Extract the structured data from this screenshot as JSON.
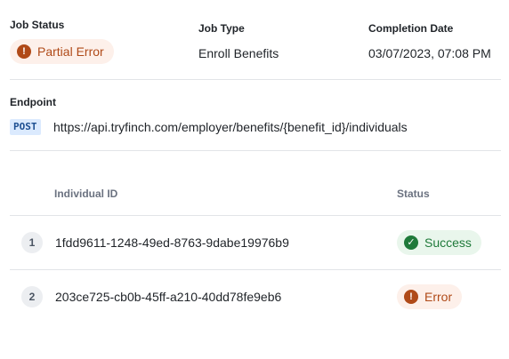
{
  "job_status": {
    "label": "Job Status",
    "value": "Partial Error",
    "icon": "alert-circle-icon",
    "color": "#b04a18"
  },
  "job_type": {
    "label": "Job Type",
    "value": "Enroll Benefits"
  },
  "completion_date": {
    "label": "Completion Date",
    "value": "03/07/2023, 07:08 PM"
  },
  "endpoint": {
    "label": "Endpoint",
    "method": "POST",
    "url": "https://api.tryfinch.com/employer/benefits/{benefit_id}/individuals"
  },
  "table": {
    "headers": {
      "individual_id": "Individual ID",
      "status": "Status"
    },
    "rows": [
      {
        "index": "1",
        "individual_id": "1fdd9611-1248-49ed-8763-9dabe19976b9",
        "status": "Success",
        "status_icon": "check-circle-icon",
        "status_color": "#1f7a3a"
      },
      {
        "index": "2",
        "individual_id": "203ce725-cb0b-45ff-a210-40dd78fe9eb6",
        "status": "Error",
        "status_icon": "alert-circle-icon",
        "status_color": "#b04a18"
      }
    ]
  }
}
